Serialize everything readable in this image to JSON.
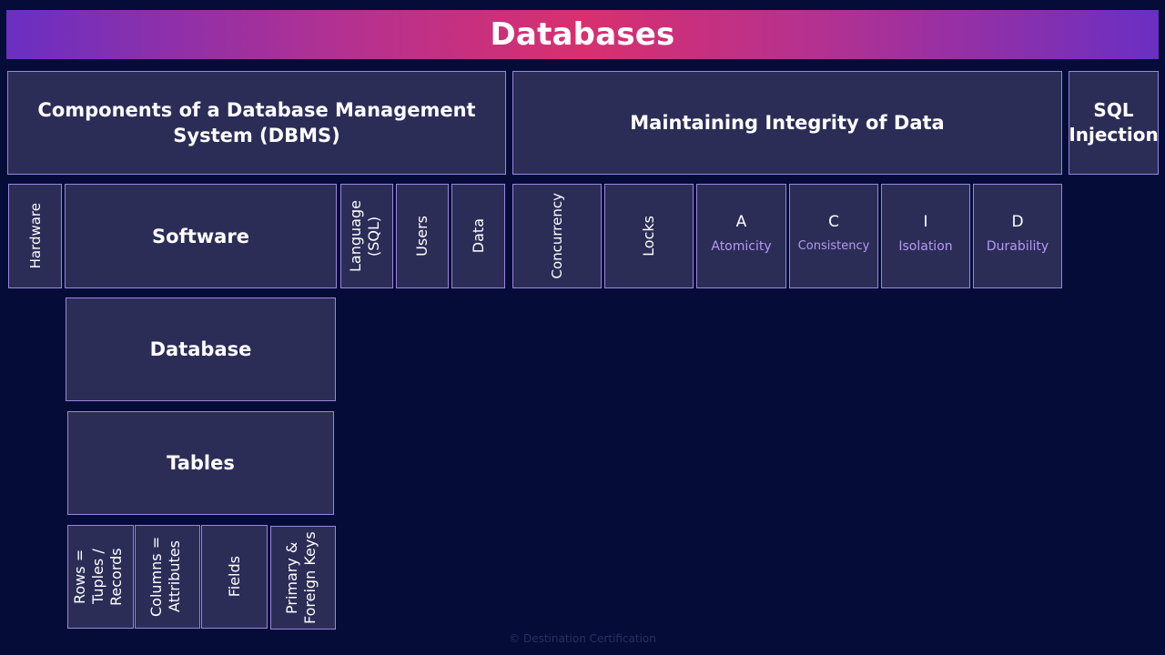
{
  "title": "Databases",
  "dbms": {
    "heading": "Components of a Database Management System (DBMS)",
    "hardware": "Hardware",
    "software": "Software",
    "language": "Language (SQL)",
    "users": "Users",
    "data": "Data",
    "database": "Database",
    "tables": "Tables",
    "table_parts": [
      "Rows = Tuples / Records",
      "Columns = Attributes",
      "Fields",
      "Primary & Foreign Keys"
    ]
  },
  "integrity": {
    "heading": "Maintaining Integrity of Data",
    "concurrency": "Concurrency",
    "locks": "Locks",
    "acid": [
      {
        "letter": "A",
        "word": "Atomicity"
      },
      {
        "letter": "C",
        "word": "Consistency"
      },
      {
        "letter": "I",
        "word": "Isolation"
      },
      {
        "letter": "D",
        "word": "Durability"
      }
    ]
  },
  "sql_injection": {
    "heading": "SQL Injection"
  },
  "footer": {
    "watermark": "© Destination Certification"
  },
  "colors": {
    "background": "#050c38",
    "box_fill": "#2b2d57",
    "box_border": "#9a86dc",
    "acid_word": "#b39af0"
  }
}
